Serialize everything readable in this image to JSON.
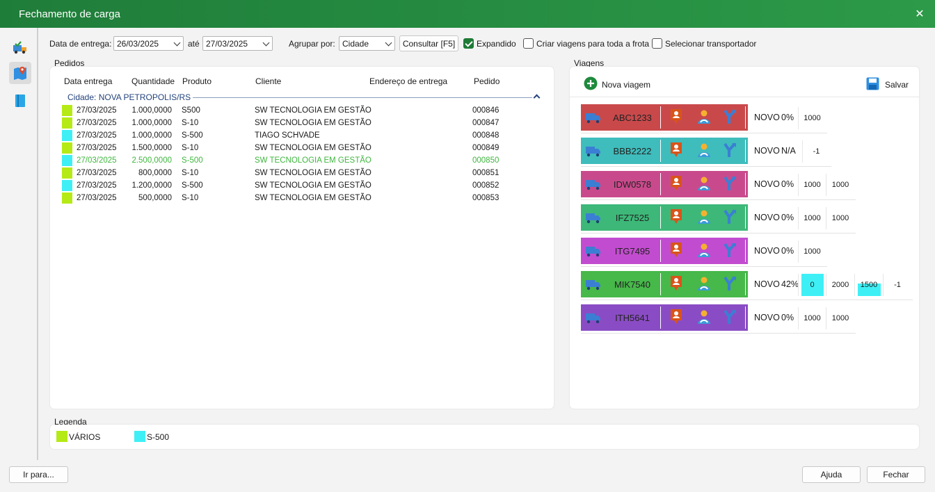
{
  "window": {
    "title": "Fechamento de carga",
    "close_symbol": "✕"
  },
  "sidebar": {
    "items": [
      "truck-check-icon",
      "map-pin-icon",
      "document-icon"
    ]
  },
  "filters": {
    "date_label": "Data de entrega:",
    "date_from": "26/03/2025",
    "until_label": "até",
    "date_to": "27/03/2025",
    "group_label": "Agrupar por:",
    "group_value": "Cidade",
    "consult_label": "Consultar [F5]",
    "expandido_label": "Expandido",
    "expandido_checked": true,
    "criar_label": "Criar viagens para toda a frota",
    "selecionar_label": "Selecionar transportador"
  },
  "pedidos": {
    "title": "Pedidos",
    "columns": [
      "Data entrega",
      "Quantidade",
      "Produto",
      "Cliente",
      "Endereço de entrega",
      "Pedido"
    ],
    "group": "Cidade: NOVA PETROPOLIS/RS",
    "rows": [
      {
        "color": "#b5ea16",
        "date": "27/03/2025",
        "qty": "1.000,0000",
        "product": "S500",
        "client": "SW TECNOLOGIA EM GESTÃO",
        "address": "",
        "order": "000846"
      },
      {
        "color": "#b5ea16",
        "date": "27/03/2025",
        "qty": "1.000,0000",
        "product": "S-10",
        "client": "SW TECNOLOGIA EM GESTÃO",
        "address": "",
        "order": "000847"
      },
      {
        "color": "#3ef0f5",
        "date": "27/03/2025",
        "qty": "1.000,0000",
        "product": "S-500",
        "client": "TIAGO SCHVADE",
        "address": "",
        "order": "000848"
      },
      {
        "color": "#b5ea16",
        "date": "27/03/2025",
        "qty": "1.500,0000",
        "product": "S-10",
        "client": "SW TECNOLOGIA EM GESTÃO",
        "address": "",
        "order": "000849"
      },
      {
        "color": "#3ef0f5",
        "date": "27/03/2025",
        "qty": "2.500,0000",
        "product": "S-500",
        "client": "SW TECNOLOGIA EM GESTÃO",
        "address": "",
        "order": "000850",
        "highlight": true
      },
      {
        "color": "#b5ea16",
        "date": "27/03/2025",
        "qty": "800,0000",
        "product": "S-10",
        "client": "SW TECNOLOGIA EM GESTÃO",
        "address": "",
        "order": "000851"
      },
      {
        "color": "#3ef0f5",
        "date": "27/03/2025",
        "qty": "1.200,0000",
        "product": "S-500",
        "client": "SW TECNOLOGIA EM GESTÃO",
        "address": "",
        "order": "000852"
      },
      {
        "color": "#b5ea16",
        "date": "27/03/2025",
        "qty": "500,0000",
        "product": "S-10",
        "client": "SW TECNOLOGIA EM GESTÃO",
        "address": "",
        "order": "000853"
      }
    ]
  },
  "viagens": {
    "title": "Viagens",
    "new_label": "Nova viagem",
    "save_label": "Salvar",
    "trips": [
      {
        "plate": "ABC1233",
        "color": "#c9494b",
        "status": "NOVO",
        "pct": "0%",
        "cells": [
          {
            "v": "1000"
          }
        ]
      },
      {
        "plate": "BBB2222",
        "color": "#3fbcbc",
        "status": "NOVO",
        "pct": "N/A",
        "cells": [
          {
            "v": "-1"
          }
        ]
      },
      {
        "plate": "IDW0578",
        "color": "#c94a8c",
        "status": "NOVO",
        "pct": "0%",
        "cells": [
          {
            "v": "1000"
          },
          {
            "v": "1000"
          }
        ]
      },
      {
        "plate": "IFZ7525",
        "color": "#3db878",
        "status": "NOVO",
        "pct": "0%",
        "cells": [
          {
            "v": "1000"
          },
          {
            "v": "1000"
          }
        ]
      },
      {
        "plate": "ITG7495",
        "color": "#c24ccf",
        "status": "NOVO",
        "pct": "0%",
        "cells": [
          {
            "v": "1000"
          }
        ]
      },
      {
        "plate": "MIK7540",
        "color": "#47b84a",
        "status": "NOVO",
        "pct": "42%",
        "cells": [
          {
            "v": "0",
            "fill": 1.0
          },
          {
            "v": "2000"
          },
          {
            "v": "1500",
            "fill": 0.55
          },
          {
            "v": "-1"
          }
        ]
      },
      {
        "plate": "ITH5641",
        "color": "#8a4cc4",
        "status": "NOVO",
        "pct": "0%",
        "cells": [
          {
            "v": "1000"
          },
          {
            "v": "1000"
          }
        ]
      }
    ]
  },
  "legenda": {
    "title": "Legenda",
    "items": [
      {
        "color": "#b5ea16",
        "label": "VÁRIOS"
      },
      {
        "color": "#3ef0f5",
        "label": "S-500"
      }
    ]
  },
  "footer": {
    "goto_label": "Ir para...",
    "help_label": "Ajuda",
    "close_label": "Fechar"
  },
  "colors": {
    "accent": "#1e7a35",
    "fill_cyan": "#3ef0f5"
  }
}
